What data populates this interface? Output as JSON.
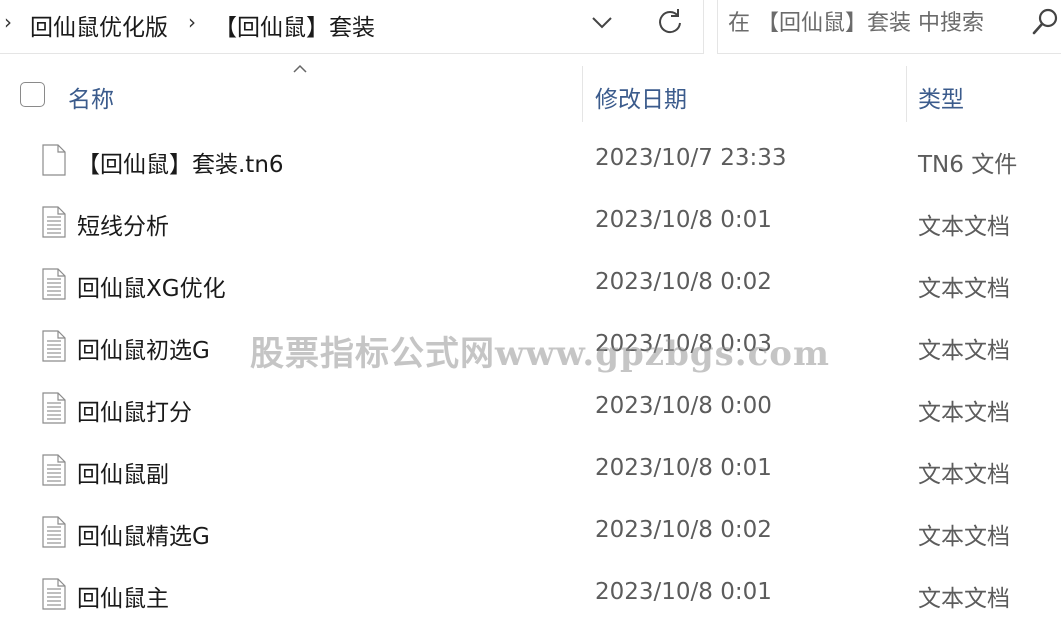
{
  "breadcrumb": {
    "items": [
      {
        "label": "回仙鼠优化版"
      },
      {
        "label": "【回仙鼠】套装"
      }
    ]
  },
  "search": {
    "placeholder": "在 【回仙鼠】套装 中搜索"
  },
  "columns": {
    "name": "名称",
    "date": "修改日期",
    "type": "类型"
  },
  "files": [
    {
      "name": "【回仙鼠】套装.tn6",
      "date": "2023/10/7 23:33",
      "type": "TN6 文件",
      "icon": "blank-file-icon"
    },
    {
      "name": "短线分析",
      "date": "2023/10/8 0:01",
      "type": "文本文档",
      "icon": "text-file-icon"
    },
    {
      "name": "回仙鼠XG优化",
      "date": "2023/10/8 0:02",
      "type": "文本文档",
      "icon": "text-file-icon"
    },
    {
      "name": "回仙鼠初选G",
      "date": "2023/10/8 0:03",
      "type": "文本文档",
      "icon": "text-file-icon"
    },
    {
      "name": "回仙鼠打分",
      "date": "2023/10/8 0:00",
      "type": "文本文档",
      "icon": "text-file-icon"
    },
    {
      "name": "回仙鼠副",
      "date": "2023/10/8 0:01",
      "type": "文本文档",
      "icon": "text-file-icon"
    },
    {
      "name": "回仙鼠精选G",
      "date": "2023/10/8 0:02",
      "type": "文本文档",
      "icon": "text-file-icon"
    },
    {
      "name": "回仙鼠主",
      "date": "2023/10/8 0:01",
      "type": "文本文档",
      "icon": "text-file-icon"
    }
  ],
  "watermark": "股票指标公式网www.gpzbgs.com",
  "colors": {
    "header_text": "#3b5b8c",
    "secondary_text": "#5c5c5c",
    "divider": "#e5e5e5"
  }
}
